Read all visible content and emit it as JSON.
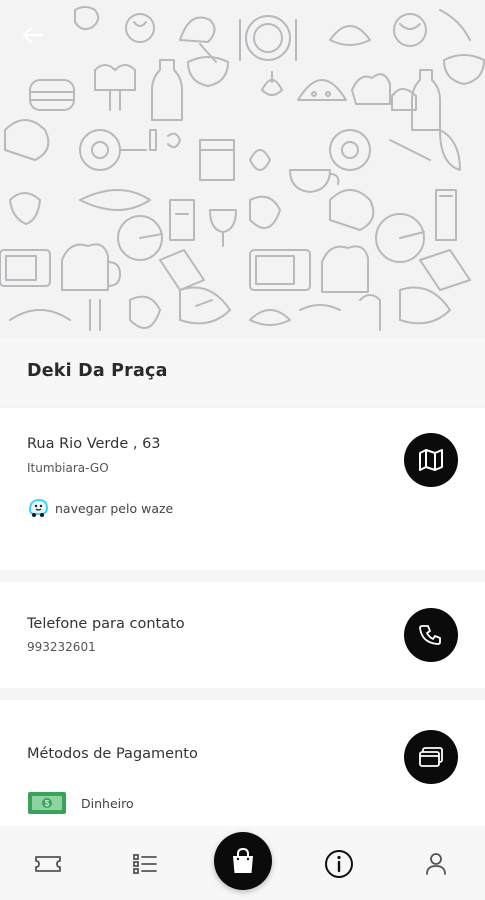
{
  "store": {
    "name": "Deki Da Praça"
  },
  "address": {
    "street": "Rua Rio Verde , 63",
    "city": "Itumbiara-GO",
    "waze_label": "navegar pelo waze"
  },
  "contact": {
    "label": "Telefone para contato",
    "phone": "993232601"
  },
  "payment": {
    "title": "Métodos de Pagamento",
    "methods": [
      {
        "label": "Dinheiro",
        "icon": "cash-icon"
      }
    ]
  },
  "nav": {
    "items": [
      {
        "icon": "ticket-icon"
      },
      {
        "icon": "menu-list-icon"
      },
      {
        "icon": "shopping-bag-icon"
      },
      {
        "icon": "info-icon"
      },
      {
        "icon": "user-icon"
      }
    ]
  },
  "colors": {
    "accent": "#0b0b0b",
    "background": "#f5f5f5",
    "card": "#ffffff",
    "pattern_stroke": "#b9b9bd",
    "waze_blue": "#33ccff",
    "cash_green": "#3aa35b"
  }
}
